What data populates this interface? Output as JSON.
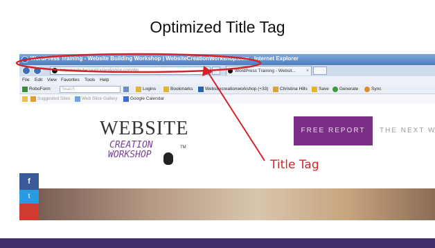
{
  "slide": {
    "title": "Optimized Title Tag"
  },
  "browser": {
    "window_title": "WordPress Training - Website Building Workshop | WebsiteCreationWorkshop.com - Internet Explorer",
    "address": "http://websitecreationworkshop.com/wp",
    "tab_label": "WordPress Training - Websit...",
    "tab_close": "×",
    "menu": [
      "File",
      "Edit",
      "View",
      "Favorites",
      "Tools",
      "Help"
    ],
    "toolbar": {
      "roboform": "RoboForm",
      "search_placeholder": "Search",
      "logins": "Logins",
      "bookmarks": "Bookmarks",
      "site": "Websitecreationworkshop (+33)",
      "user": "Christina Hills",
      "save": "Save",
      "generate": "Generate",
      "sync": "Sync"
    },
    "favorites": {
      "suggested": "Suggested Sites",
      "gallery": "Web Slice Gallery",
      "calendar": "Google Calendar"
    }
  },
  "webpage": {
    "logo_website": "WEBSITE",
    "logo_creation": "CREATION",
    "logo_workshop": "WORKSHOP",
    "logo_tm": "TM",
    "free_report": "FREE REPORT",
    "next_link": "THE NEXT W",
    "social_fb": "f",
    "social_tw": "t"
  },
  "annotation": {
    "label": "Title Tag",
    "color": "#d2232a"
  },
  "colors": {
    "footer_bar": "#3f2d6b",
    "free_report_bg": "#7b2f86"
  }
}
